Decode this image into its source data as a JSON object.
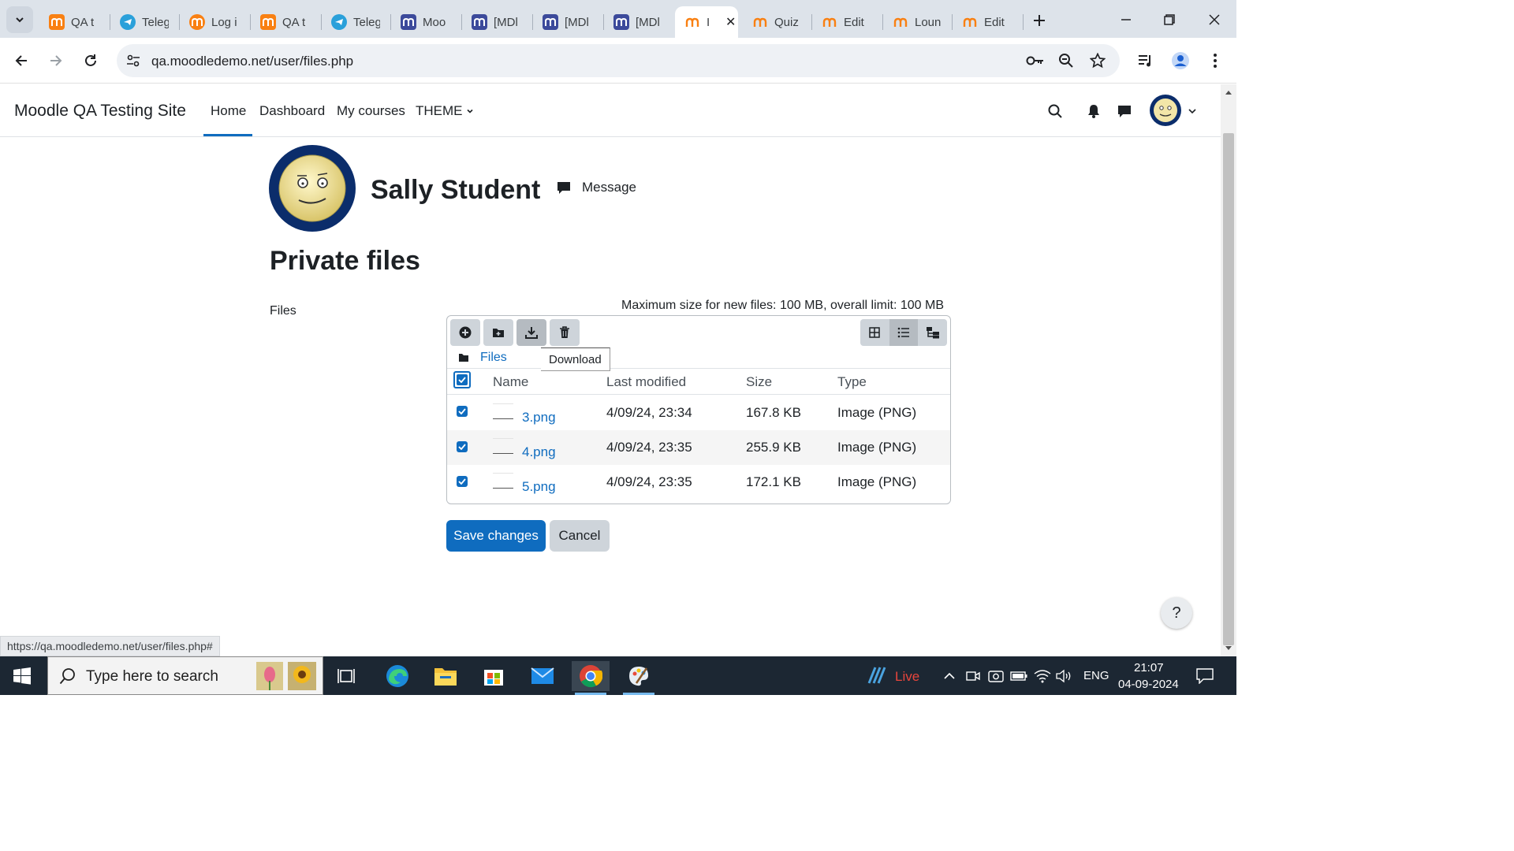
{
  "browser": {
    "tabs": [
      {
        "title": "QA t",
        "icon": "moodle-icon"
      },
      {
        "title": "Teleg",
        "icon": "telegram-icon"
      },
      {
        "title": "Log i",
        "icon": "moodle-icon"
      },
      {
        "title": "QA t",
        "icon": "moodle-icon"
      },
      {
        "title": "Teleg",
        "icon": "telegram-icon"
      },
      {
        "title": "Moo",
        "icon": "moodle-tracker-icon"
      },
      {
        "title": "[MDl",
        "icon": "moodle-tracker-icon"
      },
      {
        "title": "[MDl",
        "icon": "moodle-tracker-icon"
      },
      {
        "title": "[MDl",
        "icon": "moodle-tracker-icon"
      },
      {
        "title": "I",
        "icon": "moodle-icon",
        "active": true
      },
      {
        "title": "Quiz",
        "icon": "moodle-icon"
      },
      {
        "title": "Edit",
        "icon": "moodle-icon"
      },
      {
        "title": "Loun",
        "icon": "moodle-icon"
      },
      {
        "title": "Edit",
        "icon": "moodle-icon"
      }
    ],
    "url": "qa.moodledemo.net/user/files.php",
    "status_url": "https://qa.moodledemo.net/user/files.php#"
  },
  "moodle_nav": {
    "site_name": "Moodle QA Testing Site",
    "items": [
      {
        "label": "Home",
        "active": true
      },
      {
        "label": "Dashboard"
      },
      {
        "label": "My courses"
      },
      {
        "label": "THEME"
      }
    ]
  },
  "profile": {
    "name": "Sally Student",
    "message_label": "Message"
  },
  "page": {
    "title": "Private files",
    "files_label": "Files",
    "max_size_note": "Maximum size for new files: 100 MB, overall limit: 100 MB"
  },
  "file_manager": {
    "breadcrumb": "Files",
    "tooltip": "Download",
    "columns": [
      "Name",
      "Last modified",
      "Size",
      "Type"
    ],
    "files": [
      {
        "name": "3.png",
        "modified": "4/09/24, 23:34",
        "size": "167.8 KB",
        "type": "Image (PNG)",
        "checked": true
      },
      {
        "name": "4.png",
        "modified": "4/09/24, 23:35",
        "size": "255.9 KB",
        "type": "Image (PNG)",
        "checked": true
      },
      {
        "name": "5.png",
        "modified": "4/09/24, 23:35",
        "size": "172.1 KB",
        "type": "Image (PNG)",
        "checked": true
      }
    ]
  },
  "actions": {
    "save": "Save changes",
    "cancel": "Cancel",
    "help": "?"
  },
  "taskbar": {
    "search_placeholder": "Type here to search",
    "live_label": "Live",
    "language": "ENG",
    "time": "21:07",
    "date": "04-09-2024"
  },
  "colors": {
    "primary": "#0f6cbf",
    "secondary_btn": "#ced4da",
    "taskbar": "#1c2733",
    "live": "#e8453c"
  }
}
